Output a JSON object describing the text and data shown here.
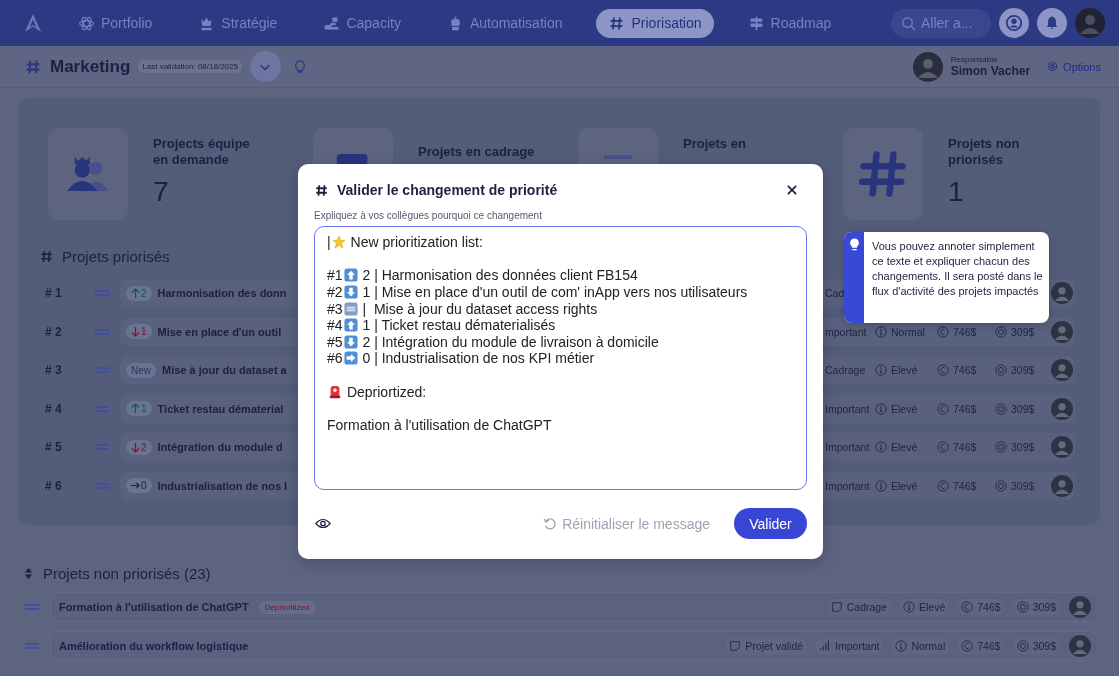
{
  "nav": {
    "items": [
      {
        "label": "Portfolio",
        "selected": false
      },
      {
        "label": "Stratégie",
        "selected": false
      },
      {
        "label": "Capacity",
        "selected": false
      },
      {
        "label": "Automatisation",
        "selected": false
      },
      {
        "label": "Priorisation",
        "selected": true
      },
      {
        "label": "Roadmap",
        "selected": false
      }
    ],
    "search": {
      "placeholder": "Aller a..."
    }
  },
  "header": {
    "title": "Marketing",
    "validation": "Last validation: 08/18/2025",
    "owner_label": "Responsable",
    "owner_name": "Simon Vacher",
    "options": "Options"
  },
  "stats": [
    {
      "title": "Projects équipe en demande",
      "value": "7"
    },
    {
      "title": "Projets en cadrage"
    },
    {
      "title": "Projets en"
    },
    {
      "title": "Projets non priorisés",
      "value": "1"
    }
  ],
  "prioritized": {
    "title": "Projets priorisés",
    "rows": [
      {
        "rank": "# 1",
        "badge": {
          "kind": "up",
          "text": "2"
        },
        "title": "Harmonisation des donn",
        "metas": [
          {
            "kind": "cut",
            "text": "Cad"
          }
        ]
      },
      {
        "rank": "# 2",
        "badge": {
          "kind": "down",
          "text": "1"
        },
        "title": "Mise en place d'un outil",
        "metas": [
          {
            "kind": "cut",
            "text": "mportant"
          },
          {
            "kind": "risk",
            "text": "Normal"
          },
          {
            "kind": "cost",
            "text": "746$"
          },
          {
            "kind": "run",
            "text": "309$"
          }
        ]
      },
      {
        "rank": "# 3",
        "badge": {
          "kind": "new",
          "text": "New"
        },
        "title": "Mise à jour du dataset a",
        "metas": [
          {
            "kind": "cut",
            "text": "Cadrage"
          },
          {
            "kind": "risk",
            "text": "Elevé"
          },
          {
            "kind": "cost",
            "text": "746$"
          },
          {
            "kind": "run",
            "text": "309$"
          }
        ]
      },
      {
        "rank": "# 4",
        "badge": {
          "kind": "up",
          "text": "1"
        },
        "title": "Ticket restau dématerial",
        "metas": [
          {
            "kind": "cut",
            "text": "Important"
          },
          {
            "kind": "risk",
            "text": "Elevé"
          },
          {
            "kind": "cost",
            "text": "746$"
          },
          {
            "kind": "run",
            "text": "309$"
          }
        ]
      },
      {
        "rank": "# 5",
        "badge": {
          "kind": "down",
          "text": "2"
        },
        "title": "Intégration du module d",
        "metas": [
          {
            "kind": "cut",
            "text": "Important"
          },
          {
            "kind": "risk",
            "text": "Elevé"
          },
          {
            "kind": "cost",
            "text": "746$"
          },
          {
            "kind": "run",
            "text": "309$"
          }
        ]
      },
      {
        "rank": "# 6",
        "badge": {
          "kind": "same",
          "text": "0"
        },
        "title": "Industrialisation de nos I",
        "metas": [
          {
            "kind": "cut",
            "text": "Important"
          },
          {
            "kind": "risk",
            "text": "Elevé"
          },
          {
            "kind": "cost",
            "text": "746$"
          },
          {
            "kind": "run",
            "text": "309$"
          }
        ]
      }
    ]
  },
  "unprioritized": {
    "title": "Projets non priorisés (23)",
    "rows": [
      {
        "title": "Formation à l'utilisation de ChatGPT",
        "tag": "Deprioritized",
        "metas": [
          {
            "kind": "phase",
            "text": "Cadrage"
          },
          {
            "kind": "risk",
            "text": "Elevé"
          },
          {
            "kind": "cost",
            "text": "746$"
          },
          {
            "kind": "run",
            "text": "309$"
          }
        ]
      },
      {
        "title": "Amélioration du workflow logistique",
        "metas": [
          {
            "kind": "phase",
            "text": "Projet validé"
          },
          {
            "kind": "priority",
            "text": "Important"
          },
          {
            "kind": "risk",
            "text": "Normal"
          },
          {
            "kind": "cost",
            "text": "746$"
          },
          {
            "kind": "run",
            "text": "309$"
          }
        ]
      }
    ]
  },
  "modal": {
    "title": "Valider le changement de priorité",
    "label": "Expliquez à vos collègues pourquoi ce changement",
    "lines": [
      {
        "kind": "text",
        "parts": [
          {
            "kind": "text",
            "text": "|"
          },
          {
            "kind": "star"
          },
          {
            "kind": "text",
            "text": " New prioritization list:"
          }
        ]
      },
      {
        "kind": "blank"
      },
      {
        "kind": "text",
        "parts": [
          {
            "kind": "text",
            "text": "#1"
          },
          {
            "kind": "up"
          },
          {
            "kind": "text",
            "text": " 2 | Harmonisation des données client FB154"
          }
        ]
      },
      {
        "kind": "text",
        "parts": [
          {
            "kind": "text",
            "text": "#2"
          },
          {
            "kind": "down"
          },
          {
            "kind": "text",
            "text": " 1 | Mise en place d'un outil de com' inApp vers nos utilisateurs"
          }
        ]
      },
      {
        "kind": "text",
        "parts": [
          {
            "kind": "text",
            "text": "#3"
          },
          {
            "kind": "new"
          },
          {
            "kind": "text",
            "text": " |  Mise à jour du dataset access rights"
          }
        ]
      },
      {
        "kind": "text",
        "parts": [
          {
            "kind": "text",
            "text": "#4"
          },
          {
            "kind": "up"
          },
          {
            "kind": "text",
            "text": " 1 | Ticket restau dématerialisés"
          }
        ]
      },
      {
        "kind": "text",
        "parts": [
          {
            "kind": "text",
            "text": "#5"
          },
          {
            "kind": "down"
          },
          {
            "kind": "text",
            "text": " 2 | Intégration du module de livraison à domicile"
          }
        ]
      },
      {
        "kind": "text",
        "parts": [
          {
            "kind": "text",
            "text": "#6"
          },
          {
            "kind": "right"
          },
          {
            "kind": "text",
            "text": " 0 | Industrialisation de nos KPI métier"
          }
        ]
      },
      {
        "kind": "blank"
      },
      {
        "kind": "text",
        "parts": [
          {
            "kind": "siren"
          },
          {
            "kind": "text",
            "text": " Depriortized:"
          }
        ]
      },
      {
        "kind": "blank"
      },
      {
        "kind": "text",
        "parts": [
          {
            "kind": "text",
            "text": "Formation à l'utilisation de ChatGPT"
          }
        ]
      }
    ],
    "reset": "Réinitialiser le message",
    "reset_disabled": true,
    "submit": "Valider"
  },
  "tooltip": {
    "text": "Vous pouvez annoter simplement ce texte et expliquer chacun des changements. Il sera posté dans le flux d'activité des projets impactés"
  }
}
